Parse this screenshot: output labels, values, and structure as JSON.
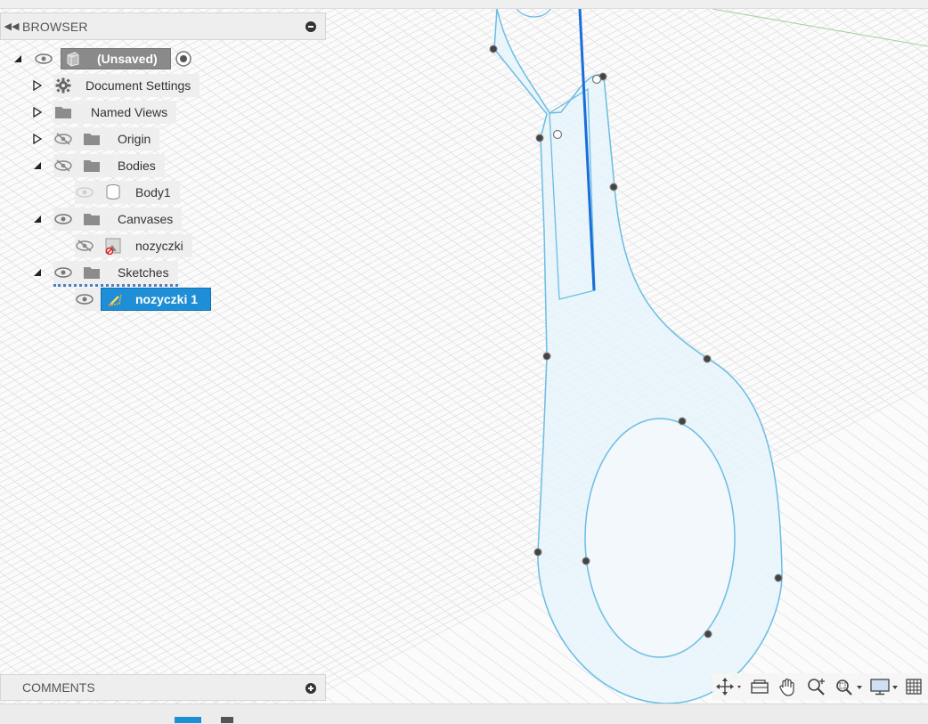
{
  "browser": {
    "title": "BROWSER",
    "root": {
      "label": "(Unsaved)"
    },
    "items": [
      {
        "label": "Document Settings"
      },
      {
        "label": "Named Views"
      },
      {
        "label": "Origin"
      },
      {
        "label": "Bodies"
      },
      {
        "label": "Body1"
      },
      {
        "label": "Canvases"
      },
      {
        "label": "nozyczki"
      },
      {
        "label": "Sketches"
      },
      {
        "label": "nozyczki 1"
      }
    ]
  },
  "comments": {
    "title": "COMMENTS"
  },
  "icons": {
    "collapse": "double-chevron-left-icon",
    "minimize": "minus-circle-icon",
    "add": "plus-circle-icon",
    "expand": "triangle-right-icon",
    "expanded": "triangle-down-icon",
    "visible": "eye-icon",
    "hidden": "eye-slash-icon",
    "settings": "gear-icon",
    "folder": "folder-icon",
    "body": "cylinder-icon",
    "canvas": "image-icon",
    "sketch": "sketch-icon",
    "component": "box-icon",
    "activate": "radio-dot-icon"
  },
  "navigation_toolbar": [
    "orbit-icon",
    "look-at-icon",
    "pan-icon",
    "zoom-icon",
    "fit-icon",
    "display-settings-icon",
    "grid-icon"
  ],
  "colors": {
    "sketch_line": "#6bbde3",
    "sketch_fill": "#e6f3fb",
    "selected_line": "#1a6ed8",
    "selection": "#1e8fd6"
  }
}
